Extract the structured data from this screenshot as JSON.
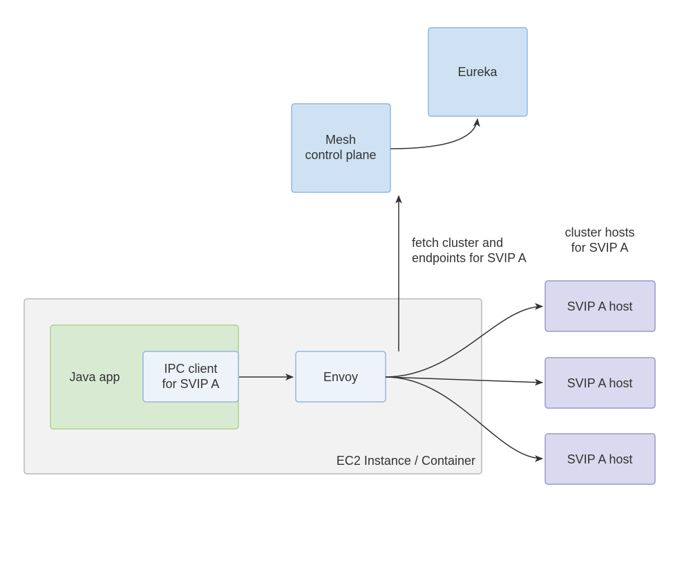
{
  "nodes": {
    "eureka": {
      "label": "Eureka"
    },
    "meshControlPlane": {
      "line1": "Mesh",
      "line2": "control plane"
    },
    "javaApp": {
      "label": "Java app"
    },
    "ipcClient": {
      "line1": "IPC client",
      "line2": "for SVIP A"
    },
    "envoy": {
      "label": "Envoy"
    },
    "svipHost1": {
      "label": "SVIP A host"
    },
    "svipHost2": {
      "label": "SVIP A host"
    },
    "svipHost3": {
      "label": "SVIP A host"
    }
  },
  "labels": {
    "ec2": "EC2 Instance / Container",
    "fetch": {
      "line1": "fetch cluster and",
      "line2": "endpoints for SVIP A"
    },
    "clusterHosts": {
      "line1": "cluster hosts",
      "line2": "for SVIP A"
    }
  },
  "colors": {
    "blueFill": "#cfe2f3",
    "blueStroke": "#8fb8e0",
    "paleBlueFill": "#edf3fa",
    "paleBlueStroke": "#99b5d6",
    "greenFill": "#d9ead3",
    "greenStroke": "#a9d18e",
    "purpleFill": "#dad9ef",
    "purpleStroke": "#9a99c9",
    "greyFill": "#f2f2f2",
    "greyStroke": "#b8b8b8"
  }
}
